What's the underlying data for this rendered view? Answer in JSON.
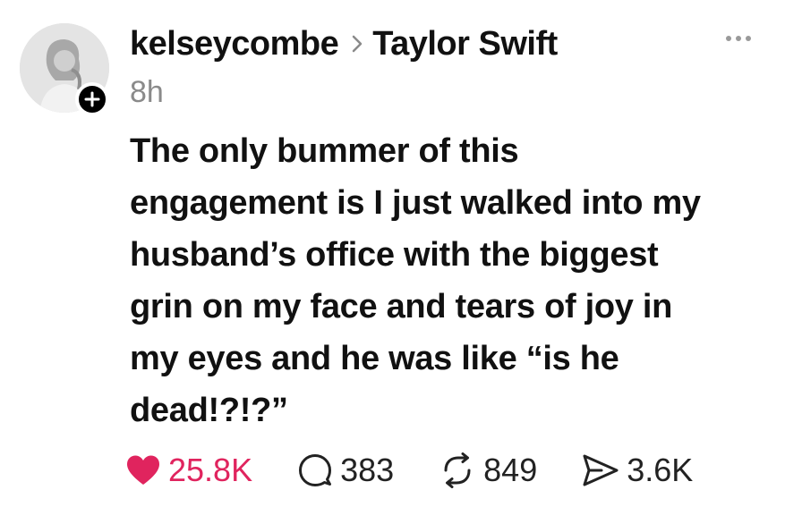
{
  "post": {
    "author": {
      "username": "kelseycombe",
      "avatar_icon": "profile-photo",
      "follow_icon": "plus-icon"
    },
    "reply_target": "Taylor Swift",
    "time": "8h",
    "body_lines": [
      "The only bummer of this",
      "engagement is I just walked into my",
      "husband’s office with the biggest",
      "grin on my face and tears of joy in",
      "my eyes and he was like “is he",
      "dead!?!?”"
    ],
    "actions": {
      "likes": "25.8K",
      "comments": "383",
      "reposts": "849",
      "shares": "3.6K"
    }
  },
  "colors": {
    "like": "#e0245e",
    "text": "#111111",
    "muted": "#8a8a8a"
  }
}
